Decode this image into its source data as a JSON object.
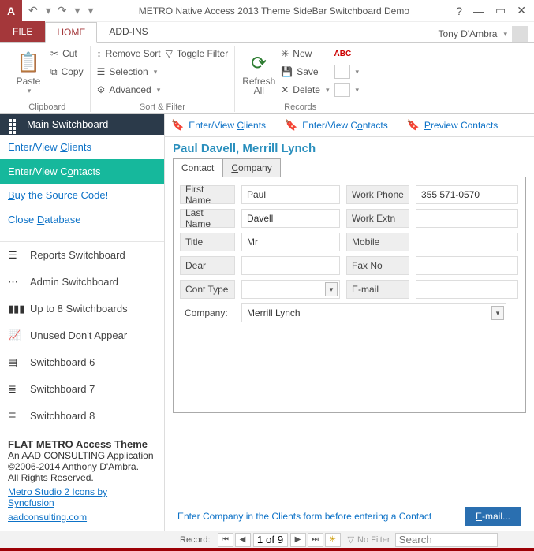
{
  "titlebar": {
    "app_letter": "A",
    "title": "METRO Native Access 2013 Theme SideBar Switchboard Demo",
    "help": "?",
    "min": "—",
    "restore": "▭",
    "close": "✕",
    "user": "Tony D'Ambra"
  },
  "tabs": {
    "file": "FILE",
    "home": "HOME",
    "addins": "ADD-INS"
  },
  "ribbon": {
    "clipboard": {
      "title": "Clipboard",
      "paste": "Paste",
      "cut": "Cut",
      "copy": "Copy"
    },
    "sortfilter": {
      "title": "Sort & Filter",
      "remove_sort": "Remove Sort",
      "selection": "Selection",
      "advanced": "Advanced",
      "toggle_filter": "Toggle Filter"
    },
    "records": {
      "title": "Records",
      "refresh": "Refresh All",
      "new": "New",
      "save": "Save",
      "delete": "Delete",
      "abc": "ABC"
    }
  },
  "sidebar": {
    "header": "Main Switchboard",
    "links": {
      "clients": "Enter/View Clients",
      "contacts": "Enter/View Contacts",
      "buy": "Buy the Source Code!",
      "close_db": "Close Database"
    },
    "items": [
      {
        "label": "Reports Switchboard"
      },
      {
        "label": "Admin Switchboard"
      },
      {
        "label": "Up to 8 Switchboards"
      },
      {
        "label": "Unused Don't Appear"
      },
      {
        "label": "Switchboard 6"
      },
      {
        "label": "Switchboard 7"
      },
      {
        "label": "Switchboard 8"
      }
    ],
    "footer": {
      "title": "FLAT METRO Access Theme",
      "subtitle": "An AAD CONSULTING Application",
      "copyright": "©2006-2014 Anthony D'Ambra.",
      "rights": "All Rights Reserved.",
      "link1": "Metro Studio 2 Icons by Syncfusion",
      "link2": "aadconsulting.com"
    }
  },
  "tabstrip": {
    "clients": "Enter/View Clients",
    "contacts": "Enter/View Contacts",
    "preview": "Preview Contacts"
  },
  "record": {
    "title": "Paul Davell, Merrill Lynch",
    "tab_contact": "Contact",
    "tab_company": "Company",
    "labels": {
      "first_name": "First Name",
      "last_name": "Last Name",
      "title": "Title",
      "dear": "Dear",
      "cont_type": "Cont Type",
      "company": "Company:",
      "work_phone": "Work Phone",
      "work_extn": "Work Extn",
      "mobile": "Mobile",
      "fax": "Fax No",
      "email": "E-mail"
    },
    "values": {
      "first_name": "Paul",
      "last_name": "Davell",
      "title": "Mr",
      "dear": "",
      "cont_type": "",
      "company": "Merrill Lynch",
      "work_phone": "355 571-0570",
      "work_extn": "",
      "mobile": "",
      "fax": "",
      "email": ""
    },
    "hint": "Enter Company in the Clients form before entering a Contact",
    "email_btn": "E-mail..."
  },
  "recnav": {
    "label": "Record:",
    "position": "1 of 9",
    "no_filter": "No Filter",
    "search_placeholder": "Search"
  }
}
